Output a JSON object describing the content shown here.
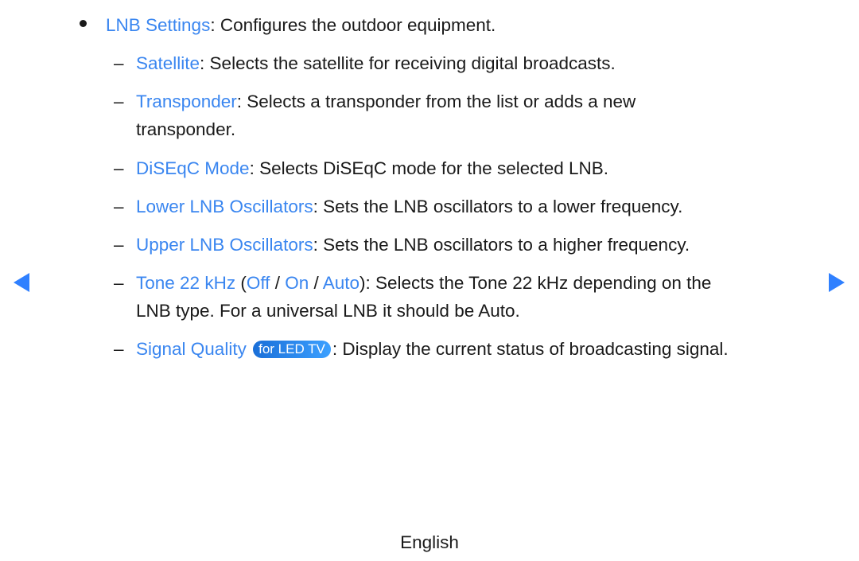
{
  "content": {
    "lnb": {
      "term": "LNB Settings",
      "desc": ": Configures the outdoor equipment."
    },
    "items": [
      {
        "term": "Satellite",
        "desc": ": Selects the satellite for receiving digital broadcasts."
      },
      {
        "term": "Transponder",
        "desc": ": Selects a transponder from the list or adds a new",
        "desc2": "transponder."
      },
      {
        "term": "DiSEqC Mode",
        "desc": ": Selects DiSEqC mode for the selected LNB."
      },
      {
        "term": "Lower LNB Oscillators",
        "desc": ": Sets the LNB oscillators to a lower frequency."
      },
      {
        "term": "Upper LNB Oscillators",
        "desc": ": Sets the LNB oscillators to a higher frequency."
      }
    ],
    "tone": {
      "term": "Tone 22 kHz",
      "open": " (",
      "opt1": "Off",
      "sep1": " / ",
      "opt2": "On",
      "sep2": " / ",
      "opt3": "Auto",
      "desc": "): Selects the Tone 22 kHz depending on the",
      "desc2": "LNB type. For a universal LNB it should be Auto."
    },
    "signal": {
      "term": "Signal Quality",
      "badge": "for LED TV",
      "desc": ": Display the current status of broadcasting signal."
    },
    "dash": "–"
  },
  "nav": {
    "prev": "previous-page",
    "next": "next-page"
  },
  "footer": {
    "language": "English"
  },
  "colors": {
    "accent": "#3a86f0",
    "arrow": "#2f80ff",
    "text": "#1a1a1a"
  }
}
